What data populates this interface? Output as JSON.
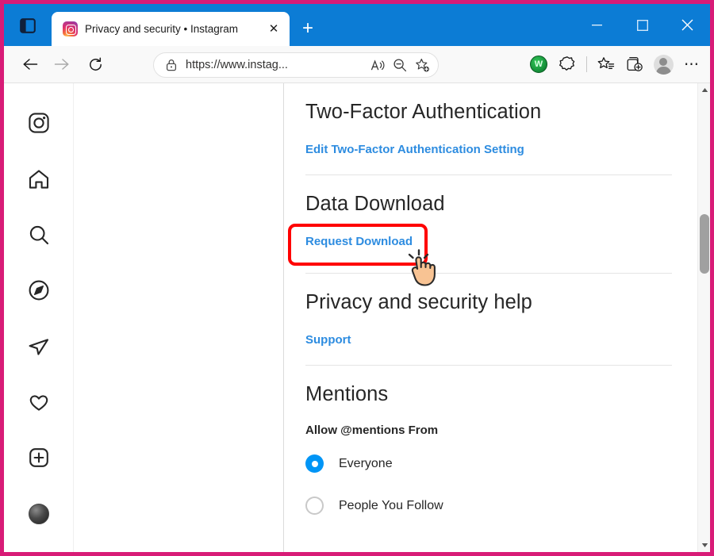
{
  "browser": {
    "titlebar": {
      "tab_actions_label": "tab-actions",
      "tab": {
        "title": "Privacy and security • Instagram",
        "favicon": "instagram-icon",
        "close_label": "✕"
      },
      "new_tab_label": "+",
      "window_controls": {
        "minimize": "minimize-icon",
        "maximize": "maximize-icon",
        "close": "close-icon"
      },
      "background_color": "#0c7cd5"
    },
    "toolbar": {
      "back": "back-icon",
      "forward": "forward-icon",
      "refresh": "refresh-icon",
      "address": {
        "lock": "lock-icon",
        "url": "https://www.instag...",
        "read_aloud": "read-aloud-icon",
        "zoom_out": "zoom-out-icon",
        "add_favorite": "add-favorite-icon"
      },
      "extension_badge": "W",
      "browser_essentials": "browser-essentials-icon",
      "favorites": "favorites-icon",
      "collections": "collections-icon",
      "profile": "profile-avatar",
      "settings_more": "⋯"
    }
  },
  "instagram": {
    "rail": [
      {
        "name": "instagram-logo-icon"
      },
      {
        "name": "home-icon"
      },
      {
        "name": "search-icon"
      },
      {
        "name": "explore-icon"
      },
      {
        "name": "messages-icon"
      },
      {
        "name": "notifications-heart-icon"
      },
      {
        "name": "create-plus-icon"
      },
      {
        "name": "profile-avatar"
      }
    ],
    "sections": {
      "two_factor": {
        "title": "Two-Factor Authentication",
        "link": "Edit Two-Factor Authentication Setting"
      },
      "data_download": {
        "title": "Data Download",
        "link": "Request Download",
        "highlighted": true,
        "highlight_color": "#ff0000"
      },
      "help": {
        "title": "Privacy and security help",
        "link": "Support"
      },
      "mentions": {
        "title": "Mentions",
        "sub_label": "Allow @mentions From",
        "options": [
          {
            "label": "Everyone",
            "selected": true
          },
          {
            "label": "People You Follow",
            "selected": false
          }
        ]
      }
    },
    "link_color": "#2d8ce0",
    "accent_color": "#0095f6"
  },
  "frame_color": "#d81b77"
}
